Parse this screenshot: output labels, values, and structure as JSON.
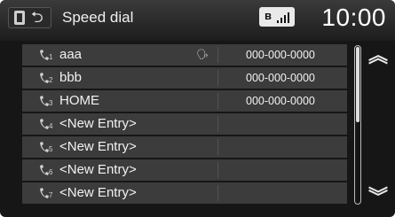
{
  "header": {
    "title": "Speed dial",
    "clock": "10:00",
    "bluetooth_icon": "bluetooth-icon",
    "signal_icon": "signal-strength-icon"
  },
  "entries": [
    {
      "slot": "1",
      "name": "aaa",
      "number": "000-000-0000",
      "voice_tag": true
    },
    {
      "slot": "2",
      "name": "bbb",
      "number": "000-000-0000",
      "voice_tag": false
    },
    {
      "slot": "3",
      "name": "HOME",
      "number": "000-000-0000",
      "voice_tag": false
    },
    {
      "slot": "4",
      "name": "<New Entry>",
      "number": "",
      "voice_tag": false
    },
    {
      "slot": "5",
      "name": "<New Entry>",
      "number": "",
      "voice_tag": false
    },
    {
      "slot": "6",
      "name": "<New Entry>",
      "number": "",
      "voice_tag": false
    },
    {
      "slot": "7",
      "name": "<New Entry>",
      "number": "",
      "voice_tag": false
    }
  ],
  "colors": {
    "background": "#161616",
    "row": "#3c3c3c",
    "text": "#f2f2f2"
  }
}
